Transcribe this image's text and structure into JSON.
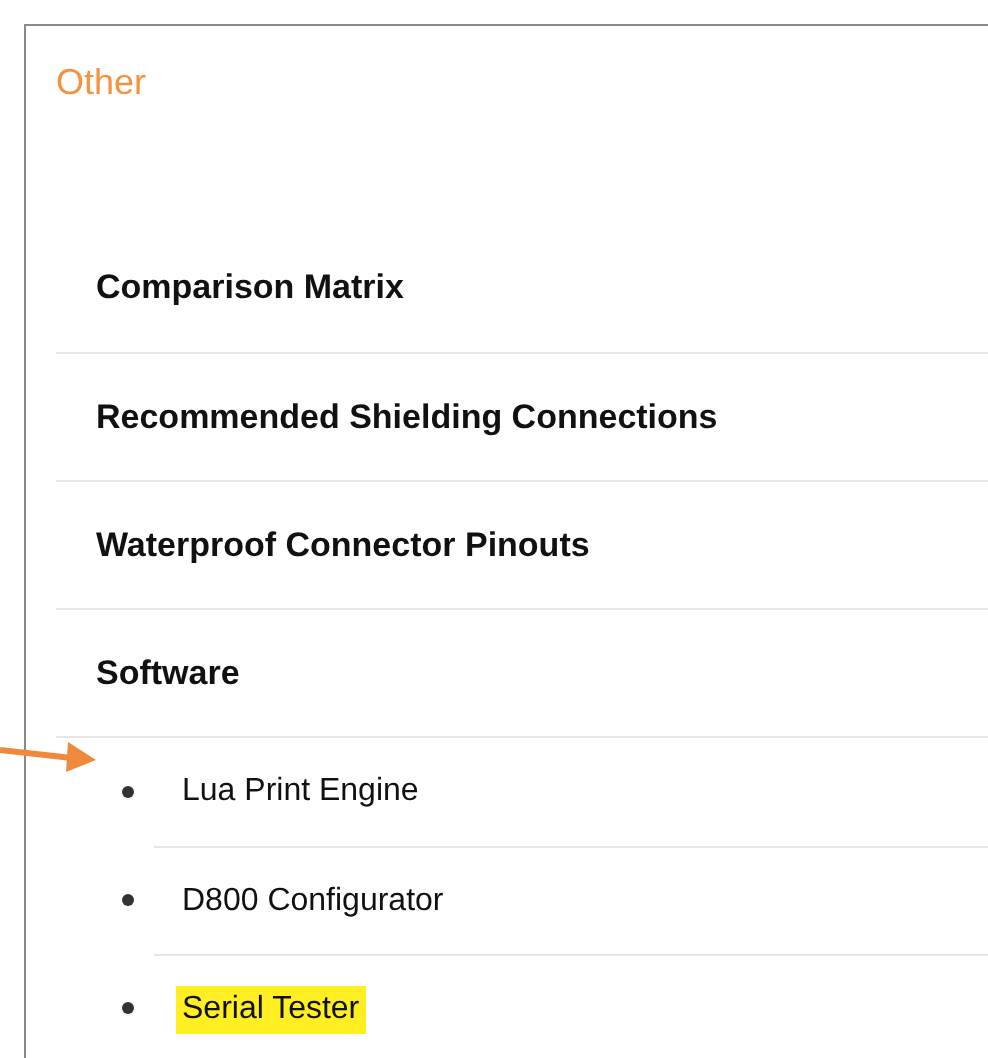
{
  "heading": "Other",
  "items": [
    {
      "label": "Comparison Matrix"
    },
    {
      "label": "Recommended Shielding Connections"
    },
    {
      "label": "Waterproof Connector Pinouts"
    },
    {
      "label": "Software",
      "children": [
        {
          "label": "Lua Print Engine",
          "highlighted": false
        },
        {
          "label": "D800 Configurator",
          "highlighted": false
        },
        {
          "label": "Serial Tester",
          "highlighted": true
        }
      ]
    }
  ]
}
